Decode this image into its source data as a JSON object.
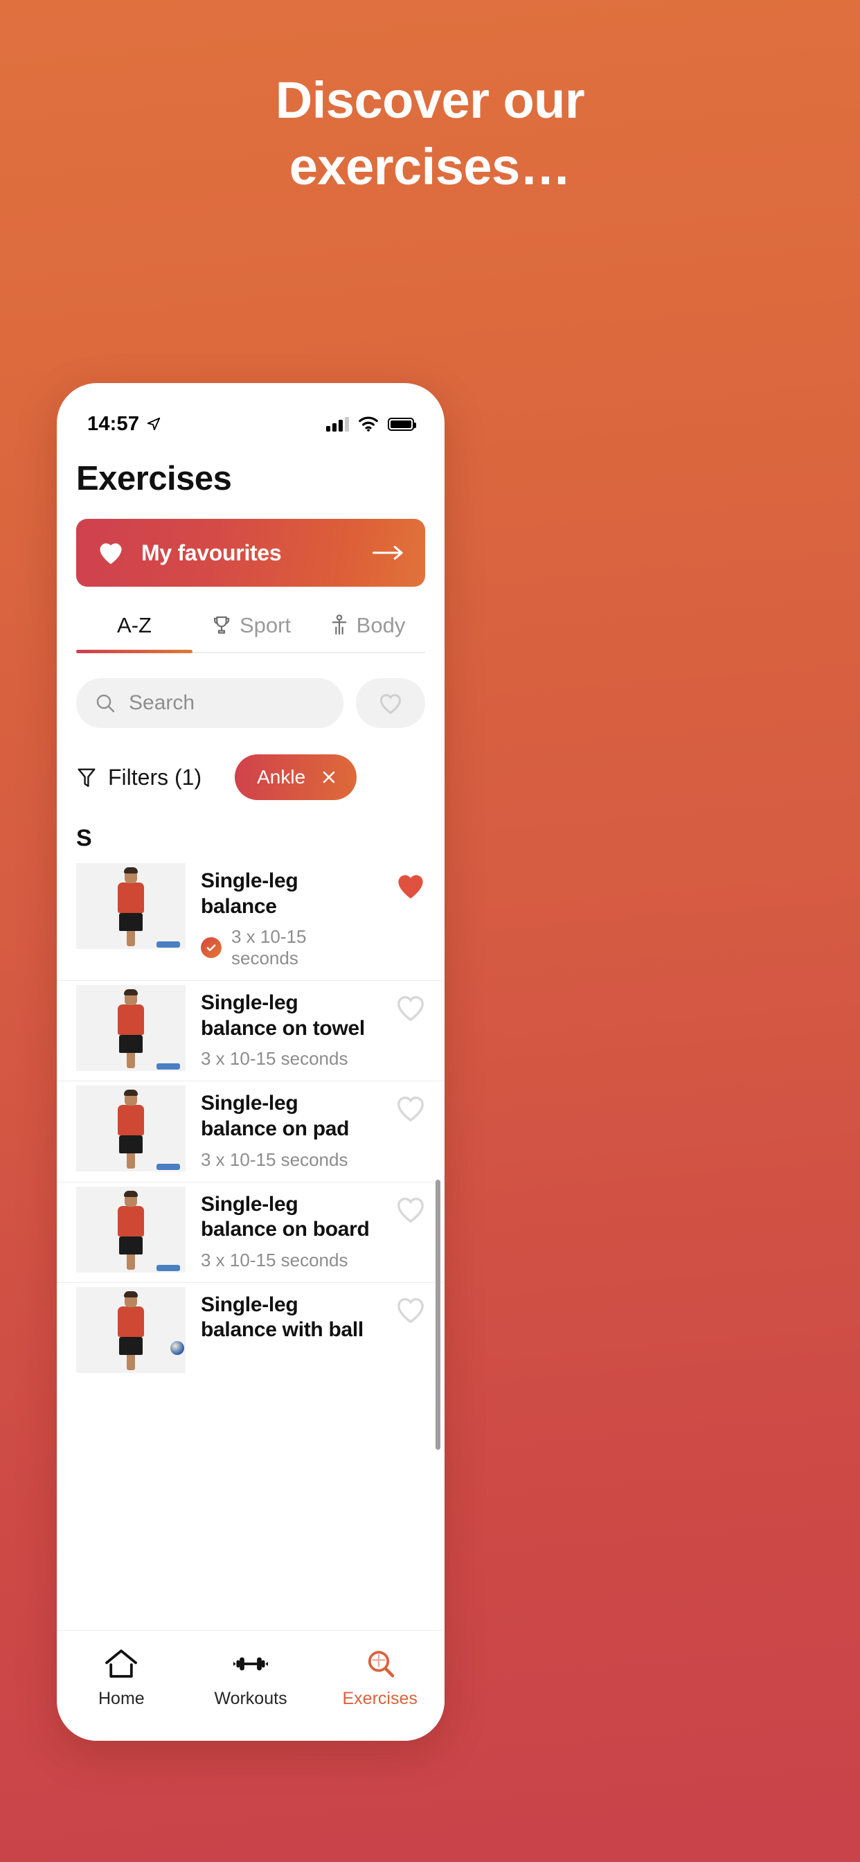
{
  "hero": {
    "line1": "Discover our",
    "line2": "exercises…"
  },
  "colors": {
    "background_start": "#e0713f",
    "background_end": "#c8434a",
    "accent_red": "#cf414f",
    "accent_orange": "#e1733a",
    "active_nav": "#d9633c"
  },
  "status_bar": {
    "time": "14:57",
    "location_icon": "location-arrow-icon",
    "signal_icon": "cellular-signal-icon",
    "wifi_icon": "wifi-icon",
    "battery_icon": "battery-full-icon"
  },
  "header": {
    "title": "Exercises"
  },
  "favourites_banner": {
    "icon": "heart-filled-icon",
    "label": "My favourites",
    "arrow_icon": "arrow-right-icon"
  },
  "tabs": [
    {
      "label": "A-Z",
      "icon": null,
      "active": true
    },
    {
      "label": "Sport",
      "icon": "trophy-icon",
      "active": false
    },
    {
      "label": "Body",
      "icon": "body-icon",
      "active": false
    }
  ],
  "search": {
    "placeholder": "Search",
    "value": "",
    "icon": "search-icon",
    "favourite_toggle_icon": "heart-outline-icon"
  },
  "filters": {
    "icon": "funnel-icon",
    "label": "Filters (1)",
    "chips": [
      {
        "label": "Ankle",
        "remove_icon": "close-icon"
      }
    ]
  },
  "list": {
    "section_letter": "S",
    "items": [
      {
        "title": "Single-leg balance",
        "subtitle": "3 x 10-15 seconds",
        "completed": true,
        "favourited": true,
        "thumbnail": "exercise-thumbnail"
      },
      {
        "title": "Single-leg balance on towel",
        "subtitle": "3 x 10-15 seconds",
        "completed": false,
        "favourited": false,
        "thumbnail": "exercise-thumbnail"
      },
      {
        "title": "Single-leg balance on pad",
        "subtitle": "3 x 10-15 seconds",
        "completed": false,
        "favourited": false,
        "thumbnail": "exercise-thumbnail"
      },
      {
        "title": "Single-leg balance on board",
        "subtitle": "3 x 10-15 seconds",
        "completed": false,
        "favourited": false,
        "thumbnail": "exercise-thumbnail"
      },
      {
        "title": "Single-leg balance with ball",
        "subtitle": "",
        "completed": false,
        "favourited": false,
        "thumbnail": "exercise-thumbnail"
      }
    ]
  },
  "bottom_nav": [
    {
      "label": "Home",
      "icon": "home-icon",
      "active": false
    },
    {
      "label": "Workouts",
      "icon": "dumbbell-icon",
      "active": false
    },
    {
      "label": "Exercises",
      "icon": "magnifier-icon",
      "active": true
    }
  ]
}
